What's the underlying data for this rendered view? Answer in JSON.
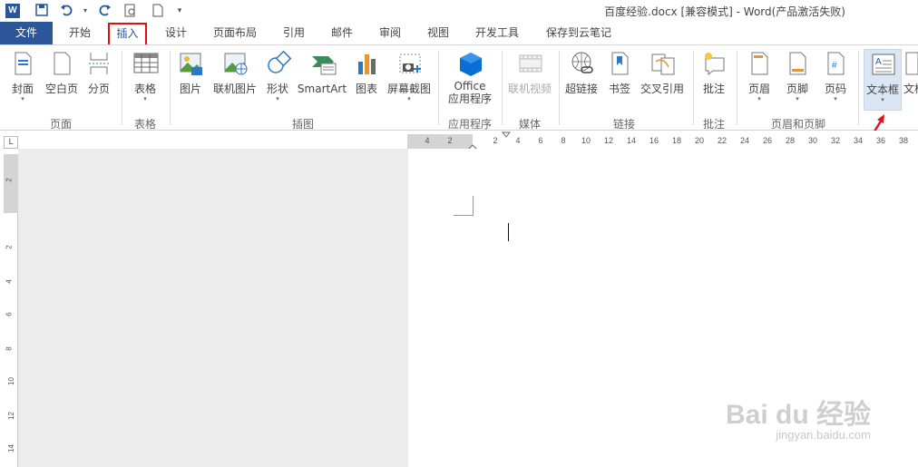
{
  "title_bar": {
    "app_logo": "W",
    "document_title": "百度经验.docx [兼容模式] - Word(产品激活失败)",
    "qat_icons": [
      "save-icon",
      "undo-icon",
      "redo-icon",
      "print-preview-icon",
      "new-document-icon",
      "customize-qat-icon"
    ]
  },
  "tabs": {
    "file": "文件",
    "items": [
      "开始",
      "插入",
      "设计",
      "页面布局",
      "引用",
      "邮件",
      "审阅",
      "视图",
      "开发工具",
      "保存到云笔记"
    ],
    "active": "插入"
  },
  "ribbon": {
    "buttons": {
      "cover": "封面",
      "blank_page": "空白页",
      "page_break": "分页",
      "table": "表格",
      "picture": "图片",
      "online_picture": "联机图片",
      "shapes": "形状",
      "smartart": "SmartArt",
      "chart": "图表",
      "screenshot": "屏幕截图",
      "office_apps_1": "Office",
      "office_apps_2": "应用程序",
      "online_video": "联机视频",
      "hyperlink": "超链接",
      "bookmark": "书签",
      "cross_ref": "交叉引用",
      "comment": "批注",
      "header": "页眉",
      "footer": "页脚",
      "page_number": "页码",
      "textbox": "文本框",
      "more": "文档"
    },
    "groups": {
      "pages": "页面",
      "tables": "表格",
      "illustrations": "插图",
      "apps": "应用程序",
      "media": "媒体",
      "links": "链接",
      "comments": "批注",
      "header_footer": "页眉和页脚"
    }
  },
  "ruler": {
    "corner": "L",
    "ticks": [
      "4",
      "2",
      "2",
      "4",
      "6",
      "8",
      "10",
      "12",
      "14",
      "16",
      "18",
      "20",
      "22",
      "24",
      "26",
      "28",
      "30",
      "32",
      "34",
      "36",
      "38"
    ],
    "vticks": [
      "2",
      "2",
      "4",
      "6",
      "8",
      "10",
      "12",
      "14"
    ]
  },
  "watermark": {
    "main": "Bai du 经验",
    "sub": "jingyan.baidu.com"
  }
}
